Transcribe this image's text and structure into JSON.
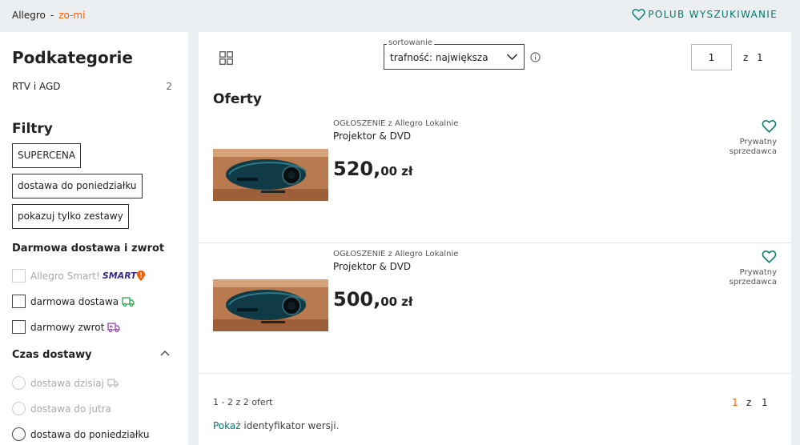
{
  "breadcrumb": {
    "root": "Allegro",
    "separator": "-",
    "current": "zo-mi"
  },
  "like_search": {
    "label": "POLUB WYSZUKIWANIE"
  },
  "sidebar": {
    "subcategories_title": "Podkategorie",
    "subcategories": [
      {
        "label": "RTV i AGD",
        "count": "2"
      }
    ],
    "filters_title": "Filtry",
    "chips": [
      "SUPERCENA",
      "dostawa do poniedziałku",
      "pokazuj tylko zestawy"
    ],
    "free_delivery_title": "Darmowa dostawa i zwrot",
    "smart": {
      "label": "Allegro Smart!",
      "badge": "SMART"
    },
    "free_delivery": "darmowa dostawa",
    "free_return": "darmowy zwrot",
    "delivery_time_title": "Czas dostawy",
    "delivery_options": [
      "dostawa dzisiaj",
      "dostawa do jutra",
      "dostawa do poniedziałku"
    ]
  },
  "main": {
    "sort": {
      "legend": "sortowanie",
      "value": "trafność: największa"
    },
    "pagination_top": {
      "page": "1",
      "of": "z",
      "total": "1"
    },
    "offers_title": "Oferty",
    "offers": [
      {
        "type": "OGŁOSZENIE z Allegro Lokalnie",
        "name": "Projektor & DVD",
        "price_int": "520,",
        "price_dec": "00",
        "currency": "zł",
        "seller_line1": "Prywatny",
        "seller_line2": "sprzedawca"
      },
      {
        "type": "OGŁOSZENIE z Allegro Lokalnie",
        "name": "Projektor & DVD",
        "price_int": "500,",
        "price_dec": "00",
        "currency": "zł",
        "seller_line1": "Prywatny",
        "seller_line2": "sprzedawca"
      }
    ],
    "range": "1 - 2 z 2 ofert",
    "pagination_bottom": {
      "page": "1",
      "of": "z",
      "total": "1"
    },
    "show_id": {
      "link": "Pokaż",
      "text": " identyfikator wersji."
    }
  },
  "colors": {
    "accent": "#ff5a00",
    "teal": "#00796b",
    "smart_purple": "#3a2a8a",
    "background": "#eceff1"
  }
}
